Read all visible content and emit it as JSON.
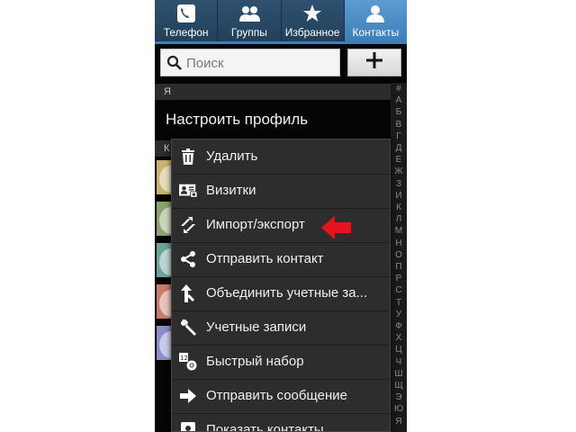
{
  "tabs": [
    {
      "label": "Телефон",
      "icon": "phone-icon",
      "active": false
    },
    {
      "label": "Группы",
      "icon": "groups-icon",
      "active": false
    },
    {
      "label": "Избранное",
      "icon": "star-icon",
      "active": false
    },
    {
      "label": "Контакты",
      "icon": "contact-icon",
      "active": true
    }
  ],
  "search": {
    "placeholder": "Поиск",
    "icon": "search-icon"
  },
  "add_button": {
    "icon": "plus-icon"
  },
  "sections": {
    "first": "Я",
    "second": "К"
  },
  "profile_label": "Настроить профиль",
  "menu": {
    "items": [
      {
        "label": "Удалить",
        "icon": "trash-icon"
      },
      {
        "label": "Визитки",
        "icon": "business-card-icon"
      },
      {
        "label": "Импорт/экспорт",
        "icon": "import-export-icon"
      },
      {
        "label": "Отправить контакт",
        "icon": "share-icon"
      },
      {
        "label": "Объединить учетные за...",
        "icon": "merge-icon"
      },
      {
        "label": "Учетные записи",
        "icon": "wrench-icon"
      },
      {
        "label": "Быстрый набор",
        "icon": "speed-dial-icon"
      },
      {
        "label": "Отправить сообщение",
        "icon": "send-arrow-icon"
      },
      {
        "label": "Показать контакты",
        "icon": "show-contacts-icon"
      }
    ]
  },
  "index_letters": [
    "#",
    "А",
    "Б",
    "В",
    "Г",
    "Д",
    "Е",
    "Ж",
    "З",
    "И",
    "К",
    "Л",
    "М",
    "Н",
    "О",
    "П",
    "Р",
    "С",
    "Т",
    "У",
    "Ф",
    "Х",
    "Ц",
    "Ч",
    "Ш",
    "Щ",
    "Э",
    "Ю",
    "Я"
  ],
  "colors": {
    "tab_active": "#3d7fb8",
    "tab_inactive": "#2a4a66",
    "menu_bg": "#2d2d2d",
    "annotation_arrow": "#e8141c",
    "avatars": [
      "#c9b46a",
      "#8aa36a",
      "#6aa39a",
      "#c97a6a",
      "#8a8fc9"
    ]
  }
}
